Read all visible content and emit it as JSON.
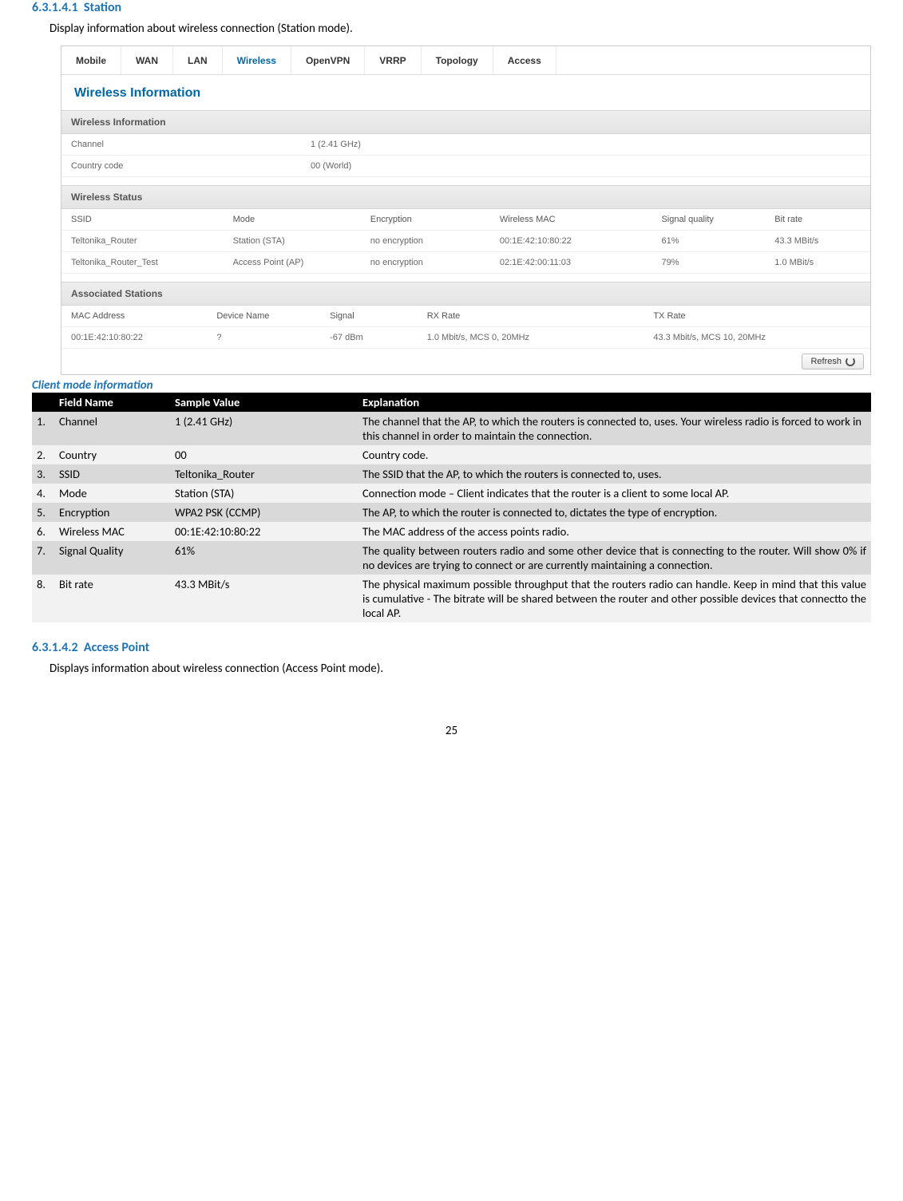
{
  "sec1": {
    "num": "6.3.1.4.1",
    "title": "Station",
    "intro": "Display information about wireless connection (Station mode)."
  },
  "shot": {
    "tabs": [
      "Mobile",
      "WAN",
      "LAN",
      "Wireless",
      "OpenVPN",
      "VRRP",
      "Topology",
      "Access"
    ],
    "activeTab": "Wireless",
    "panelTitle": "Wireless Information",
    "info": {
      "header": "Wireless Information",
      "rows": [
        {
          "k": "Channel",
          "v": "1 (2.41 GHz)"
        },
        {
          "k": "Country code",
          "v": "00 (World)"
        }
      ]
    },
    "status": {
      "header": "Wireless Status",
      "cols": [
        "SSID",
        "Mode",
        "Encryption",
        "Wireless MAC",
        "Signal quality",
        "Bit rate"
      ],
      "rows": [
        [
          "Teltonika_Router",
          "Station (STA)",
          "no encryption",
          "00:1E:42:10:80:22",
          "61%",
          "43.3 MBit/s"
        ],
        [
          "Teltonika_Router_Test",
          "Access Point (AP)",
          "no encryption",
          "02:1E:42:00:11:03",
          "79%",
          "1.0 MBit/s"
        ]
      ]
    },
    "assoc": {
      "header": "Associated Stations",
      "cols": [
        "MAC Address",
        "Device Name",
        "Signal",
        "RX Rate",
        "TX Rate"
      ],
      "rows": [
        [
          "00:1E:42:10:80:22",
          "?",
          "-67 dBm",
          "1.0 Mbit/s, MCS 0, 20MHz",
          "43.3 Mbit/s, MCS 10, 20MHz"
        ]
      ]
    },
    "refresh": "Refresh"
  },
  "caption": "Client mode information",
  "fields": {
    "header": {
      "c0": "",
      "c1": "Field Name",
      "c2": "Sample Value",
      "c3": "Explanation"
    },
    "rows": [
      {
        "n": "1.",
        "name": "Channel",
        "sample": "1 (2.41 GHz)",
        "expl": "The channel that the AP, to which the routers is connected to, uses. Your wireless radio is forced to work in this channel in order to maintain the connection."
      },
      {
        "n": "2.",
        "name": "Country",
        "sample": "00",
        "expl": "Country code."
      },
      {
        "n": "3.",
        "name": "SSID",
        "sample": "Teltonika_Router",
        "expl": "The SSID that the AP, to which the routers is connected to, uses."
      },
      {
        "n": "4.",
        "name": "Mode",
        "sample": "Station (STA)",
        "expl": "Connection mode – Client indicates that the router is a client to some local AP.",
        "justify": true
      },
      {
        "n": "5.",
        "name": "Encryption",
        "sample": "WPA2 PSK (CCMP)",
        "expl": "The AP, to which the router is connected to, dictates the type of encryption.",
        "justify": true
      },
      {
        "n": "6.",
        "name": "Wireless MAC",
        "sample": "00:1E:42:10:80:22",
        "expl": "The MAC address of the access points radio."
      },
      {
        "n": "7.",
        "name": "Signal Quality",
        "sample": "61%",
        "expl": "The quality between routers radio and some other device that is connecting to the router. Will show 0% if no devices are trying to connect or are currently maintaining a connection.",
        "justify": true
      },
      {
        "n": "8.",
        "name": "Bit rate",
        "sample": "43.3 MBit/s",
        "expl": "The physical maximum possible throughput that the routers radio can handle. Keep in mind that this value is cumulative - The bitrate will be shared between the router and other possible devices that connectto the local AP.",
        "justify": true
      }
    ]
  },
  "sec2": {
    "num": "6.3.1.4.2",
    "title": "Access Point",
    "intro": "Displays information about wireless connection (Access Point mode)."
  },
  "pageNum": "25"
}
